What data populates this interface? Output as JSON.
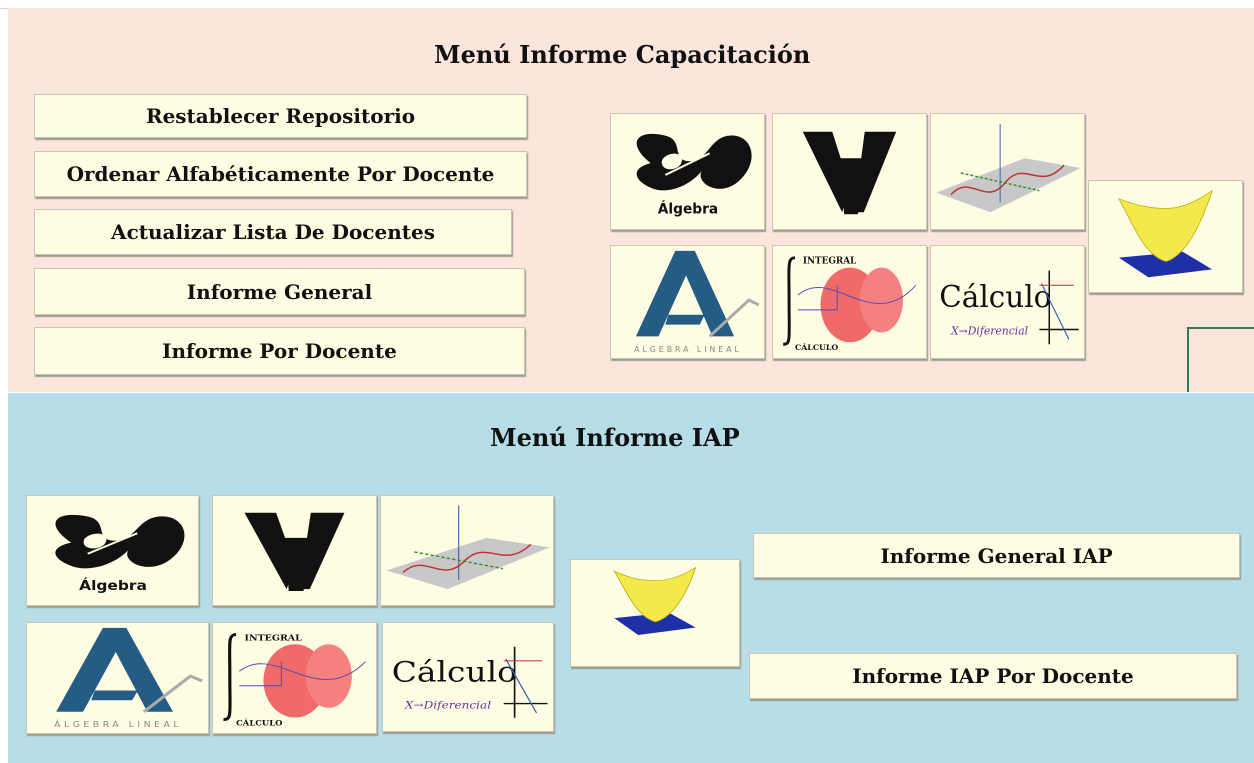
{
  "capacitacion": {
    "title": "Menú Informe Capacitación",
    "buttons": [
      "Restablecer Repositorio",
      "Ordenar Alfabéticamente Por Docente",
      "Actualizar Lista De Docentes",
      "Informe General",
      "Informe Por Docente"
    ]
  },
  "iap": {
    "title": "Menú Informe IAP",
    "buttons": [
      "Informe General IAP",
      "Informe IAP Por Docente"
    ]
  },
  "logos": {
    "algebra": "Álgebra",
    "integral_top": "INTEGRAL",
    "integral_bottom": "CÁLCULO",
    "calculo": "Cálculo",
    "diferencial": "X→Diferencial",
    "algebra_lineal": "ÁLGEBRA LINEAL"
  },
  "icons": [
    "algebra-logo-icon",
    "vector-v-logo-icon",
    "sine-wave-plane-icon",
    "parabolic-surface-icon",
    "algebra-lineal-logo-icon",
    "integral-solid-icon",
    "calculo-diferencial-icon"
  ],
  "colors": {
    "top_panel": "#fbe5dc",
    "bottom_panel": "#b7dde8",
    "button_face": "#fefde3"
  }
}
